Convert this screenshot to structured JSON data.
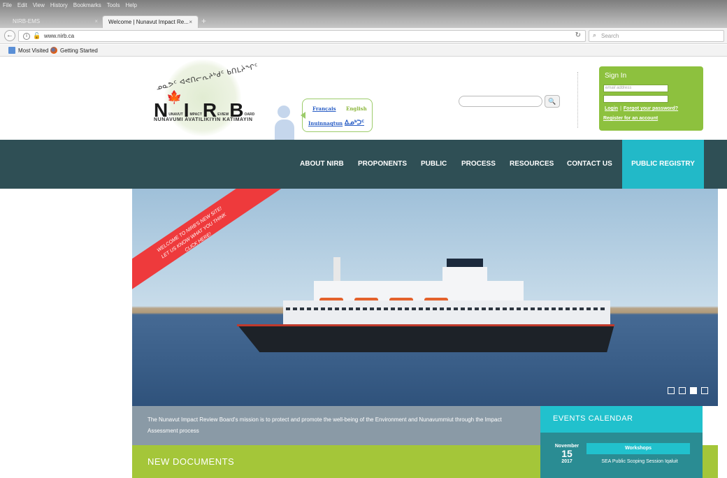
{
  "browser": {
    "menu": [
      "File",
      "Edit",
      "View",
      "History",
      "Bookmarks",
      "Tools",
      "Help"
    ],
    "tabs": [
      {
        "label": "NIRB-EMS",
        "close": "×"
      },
      {
        "label": "Welcome | Nunavut Impact Re...",
        "close": "×"
      }
    ],
    "new_tab": "+",
    "url": "www.nirb.ca",
    "search_placeholder": "Search",
    "bookmarks": [
      "Most Visited",
      "Getting Started"
    ]
  },
  "header": {
    "logo_syllabics": "ᓄᓇᕗᑦ ᐊᕙᑎᓕᕆᔨᒃᑯᑦ ᑲᑎᒪᔩᖏᑦ",
    "logo_letters": [
      "N",
      "I",
      "R",
      "B"
    ],
    "logo_small": [
      "UNAVUT",
      "MPACT",
      "EVIEW",
      "OARD"
    ],
    "logo_subtitle": "NUNAVUMI AVATILIKIYIN KATIMAYIN",
    "languages": {
      "french": "Français",
      "english": "English",
      "inuinnaqtun": "Inuinnaqtun",
      "syllabics": "ᐃᓄᒃᑐᑦ"
    },
    "search_button": "🔍",
    "signin": {
      "title": "Sign In",
      "email_placeholder": "email address",
      "login": "Login",
      "separator": "|",
      "forgot": "Forgot your password?",
      "register": "Register for an account"
    }
  },
  "nav": {
    "items": [
      "ABOUT NIRB",
      "PROPONENTS",
      "PUBLIC",
      "PROCESS",
      "RESOURCES",
      "CONTACT US"
    ],
    "registry": "PUBLIC REGISTRY"
  },
  "hero": {
    "ribbon_line1": "WELCOME TO NIRB'S NEW SITE!",
    "ribbon_line2": "LET US KNOW WHAT YOU THINK",
    "ribbon_line3": "CLICK HERE!",
    "slides_total": 4,
    "active_slide": 3
  },
  "mission": {
    "text": "The Nunavut Impact Review Board's mission is to protect and promote the well-being of the Environment and Nunavummiut through the Impact Assessment process"
  },
  "new_documents": {
    "title": "NEW DOCUMENTS"
  },
  "events": {
    "title": "EVENTS CALENDAR",
    "items": [
      {
        "month": "November",
        "day": "15",
        "year": "2017",
        "tag": "Workshops",
        "name": "SEA Public Scoping Session Iqaluit"
      }
    ]
  },
  "colors": {
    "nav_bg": "#2f4f55",
    "registry_bg": "#22b9c8",
    "signin_bg": "#8dc13e",
    "ribbon": "#ee3a3c",
    "events_head": "#21c1cd",
    "new_docs_bg": "#a4c639"
  }
}
